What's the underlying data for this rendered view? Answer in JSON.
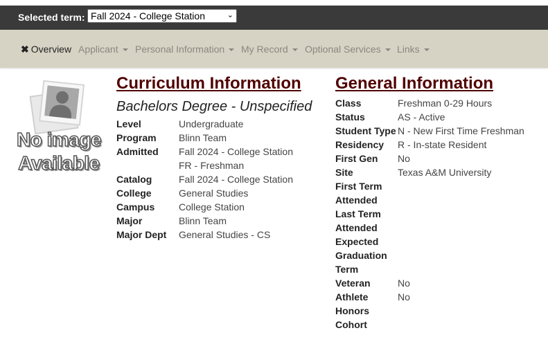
{
  "term_bar": {
    "label": "Selected term:",
    "selected": "Fall 2024 - College Station"
  },
  "nav": {
    "overview": "Overview",
    "applicant": "Applicant",
    "personal": "Personal Information",
    "record": "My Record",
    "optional": "Optional Services",
    "links": "Links"
  },
  "photo": {
    "line1": "No image",
    "line2": "Available"
  },
  "curriculum": {
    "title": "Curriculum Information",
    "degree": "Bachelors Degree - Unspecified",
    "level_label": "Level",
    "level": "Undergraduate",
    "program_label": "Program",
    "program": "Blinn Team",
    "admitted_label": "Admitted",
    "admitted_1": "Fall 2024 - College Station",
    "admitted_2": "FR - Freshman",
    "catalog_label": "Catalog",
    "catalog": "Fall 2024 - College Station",
    "college_label": "College",
    "college": "General Studies",
    "campus_label": "Campus",
    "campus": "College Station",
    "major_label": "Major",
    "major": "Blinn Team",
    "dept_label": "Major Dept",
    "dept": "General Studies - CS"
  },
  "general": {
    "title": "General Information",
    "class_label": "Class",
    "class": "Freshman 0-29 Hours",
    "status_label": "Status",
    "status": "AS - Active",
    "type_label": "Student Type",
    "type": "N - New First Time Freshman",
    "res_label": "Residency",
    "res": "R - In-state Resident",
    "firstgen_label": "First Gen",
    "firstgen": "No",
    "site_label": "Site",
    "site": "Texas A&M University",
    "fta_1": "First Term",
    "fta_2": "Attended",
    "lta_1": "Last Term",
    "lta_2": "Attended",
    "egt_1": "Expected",
    "egt_2": "Graduation",
    "egt_3": "Term",
    "veteran_label": "Veteran",
    "veteran": "No",
    "athlete_label": "Athlete",
    "athlete": "No",
    "honors_label": "Honors",
    "cohort_label": "Cohort"
  }
}
